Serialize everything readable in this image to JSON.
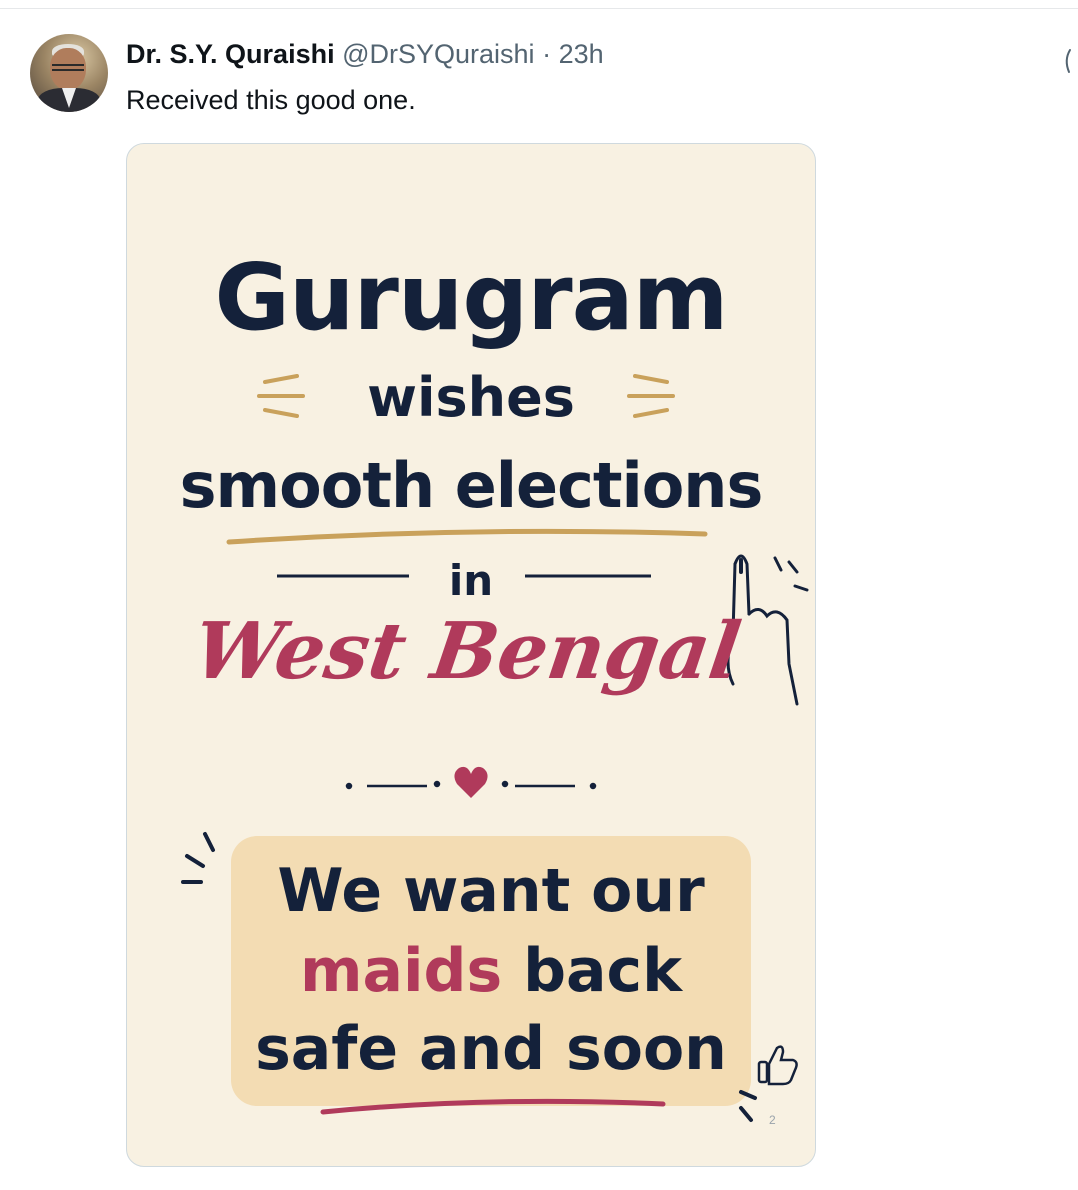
{
  "tweet": {
    "author_name": "Dr. S.Y. Quraishi",
    "handle": "@DrSYQuraishi",
    "separator": "·",
    "time": "23h",
    "text": "Received this good one."
  },
  "poster": {
    "line1": "Gurugram",
    "line2": "wishes",
    "line3": "smooth elections",
    "line4": "in",
    "place": "West Bengal",
    "message_line1": "We want our",
    "message_maids": "maids",
    "message_back": " back",
    "message_line3": "safe and soon",
    "reaction_count": "2"
  },
  "colors": {
    "poster_background": "#f8f1e2",
    "navy_text": "#14213a",
    "accent_pink": "#b03a5b",
    "gold_accent": "#c9a15b",
    "message_box": "#f3dcb3"
  },
  "icons": {
    "avatar": "profile-photo",
    "more": "more-icon",
    "finger": "inked-finger-icon",
    "heart": "heart-icon",
    "like": "thumbs-up-icon"
  }
}
